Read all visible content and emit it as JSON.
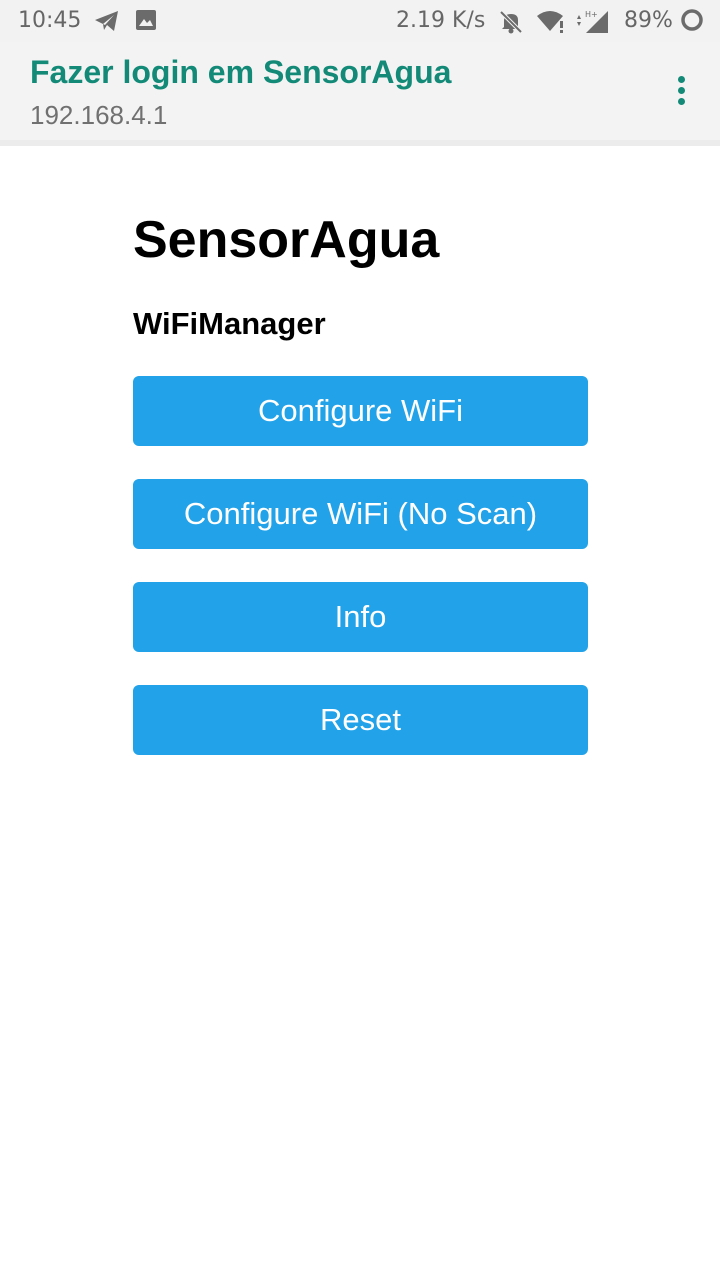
{
  "status_bar": {
    "time": "10:45",
    "network_speed": "2.19 K/s",
    "battery": "89%",
    "icons": [
      "telegram-icon",
      "image-icon",
      "mute-icon",
      "wifi-icon",
      "signal-icon",
      "battery-icon"
    ]
  },
  "app_bar": {
    "title": "Fazer login em SensorAgua",
    "subtitle": "192.168.4.1",
    "accent_color": "#138a78"
  },
  "page": {
    "title": "SensorAgua",
    "section": "WiFiManager",
    "buttons": [
      {
        "label": "Configure WiFi"
      },
      {
        "label": "Configure WiFi (No Scan)"
      },
      {
        "label": "Info"
      },
      {
        "label": "Reset"
      }
    ],
    "button_color": "#22a2e8"
  }
}
